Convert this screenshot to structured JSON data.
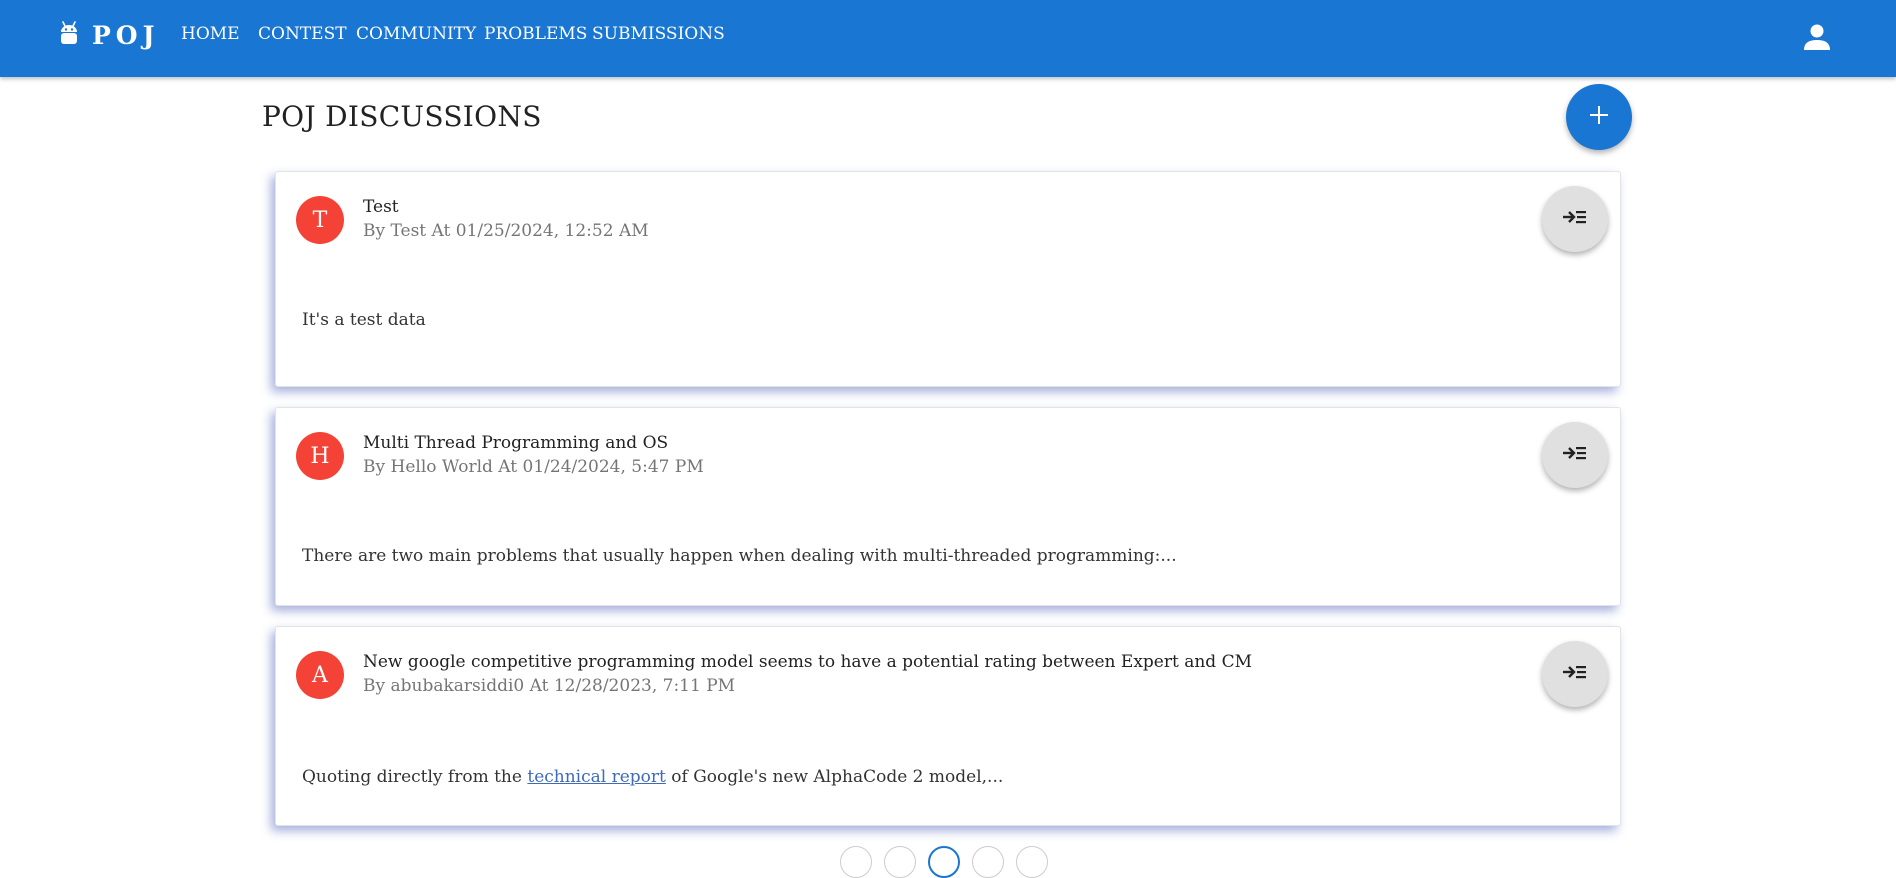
{
  "header": {
    "logo_text": "POJ",
    "nav": [
      {
        "label": "HOME"
      },
      {
        "label": "CONTEST"
      },
      {
        "label": "COMMUNITY"
      },
      {
        "label": "PROBLEMS"
      },
      {
        "label": "SUBMISSIONS"
      }
    ]
  },
  "page": {
    "title": "POJ DISCUSSIONS"
  },
  "posts": [
    {
      "avatar_letter": "T",
      "title": "Test",
      "subtitle": "By Test At 01/25/2024, 12:52 AM",
      "body": "It's a test data"
    },
    {
      "avatar_letter": "H",
      "title": "Multi Thread Programming and OS",
      "subtitle": "By Hello World At 01/24/2024, 5:47 PM",
      "body": "There are two main problems that usually happen when dealing with multi-threaded programming:..."
    },
    {
      "avatar_letter": "A",
      "title": "New google competitive programming model seems to have a potential rating between Expert and CM",
      "subtitle": "By abubakarsiddi0 At 12/28/2023, 7:11 PM",
      "body_before": "Quoting directly from the",
      "body_link": "technical report",
      "body_after": "of Google's new AlphaCode 2 model,..."
    }
  ],
  "colors": {
    "appbar": "#1976d2",
    "avatar": "#f44336",
    "fab": "#1976d2",
    "expand_button": "#e0e0e0",
    "link": "#3f6ab8"
  },
  "icons": {
    "logo": "android-icon",
    "user": "account-icon",
    "add": "plus-icon",
    "expand": "expand-icon"
  }
}
